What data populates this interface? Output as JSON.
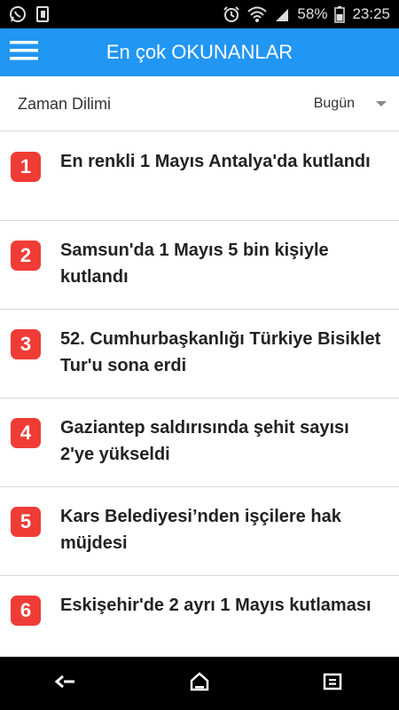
{
  "status_bar": {
    "icons_left": [
      "whatsapp-icon",
      "sim-card-icon"
    ],
    "icons_right": [
      "alarm-icon",
      "wifi-icon",
      "signal-icon",
      "battery-icon"
    ],
    "battery": "58%",
    "time": "23:25"
  },
  "app_bar": {
    "title": "En çok OKUNANLAR",
    "menu_icon": "hamburger-menu-icon",
    "color": "#2196f3"
  },
  "filter": {
    "label": "Zaman Dilimi",
    "selected": "Bugün"
  },
  "news": [
    {
      "rank": "1",
      "title": "En renkli 1 Mayıs Antalya'da kutlandı"
    },
    {
      "rank": "2",
      "title": "Samsun'da 1 Mayıs 5 bin kişiyle kutlandı"
    },
    {
      "rank": "3",
      "title": "52. Cumhurbaşkanlığı Türkiye Bisiklet Tur'u sona erdi"
    },
    {
      "rank": "4",
      "title": "Gaziantep saldırısında şehit sayısı 2'ye yükseldi"
    },
    {
      "rank": "5",
      "title": "Kars Belediyesi’nden işçilere hak müjdesi"
    },
    {
      "rank": "6",
      "title": "Eskişehir'de 2 ayrı 1 Mayıs kutlaması"
    }
  ],
  "badge_color": "#f03c36",
  "nav_bar": {
    "icons": [
      "back-icon",
      "home-icon",
      "recents-icon"
    ]
  }
}
